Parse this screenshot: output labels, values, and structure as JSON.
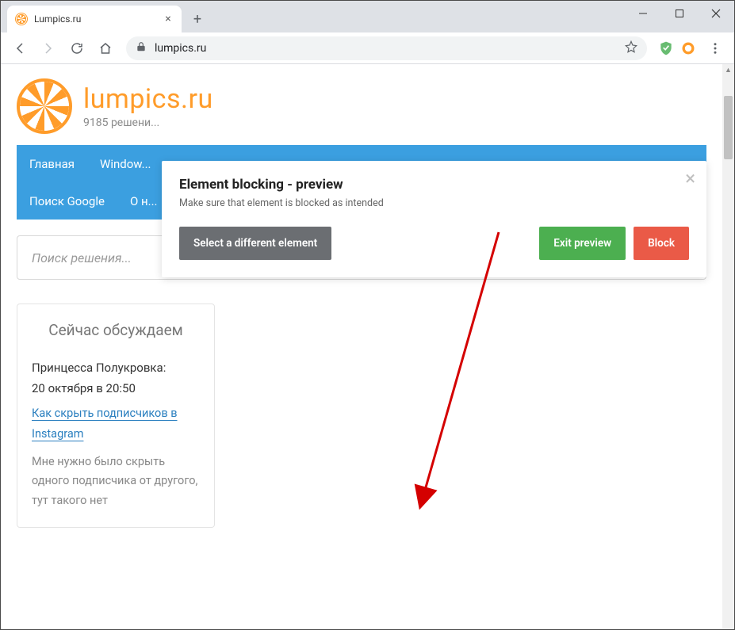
{
  "window": {
    "tab_title": "Lumpics.ru",
    "url": "lumpics.ru"
  },
  "site": {
    "title": "lumpics.ru",
    "subtitle": "9185 решени..."
  },
  "nav": {
    "row1": [
      "Главная",
      "Window..."
    ],
    "row2": [
      "Поиск Google",
      "О н..."
    ]
  },
  "popup": {
    "title": "Element blocking - preview",
    "subtitle": "Make sure that element is blocked as intended",
    "select_label": "Select a different element",
    "exit_label": "Exit preview",
    "block_label": "Block"
  },
  "search": {
    "placeholder": "Поиск решения..."
  },
  "widget": {
    "title": "Сейчас обсуждаем",
    "comment": {
      "author": "Принцесса Полукровка:",
      "date": "20 октября в 20:50",
      "link": "Как скрыть подписчиков в Instagram",
      "body": "Мне нужно было скрыть одного подписчика от другого, тут такого нет"
    }
  }
}
